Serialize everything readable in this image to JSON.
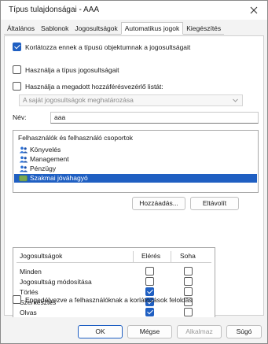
{
  "window": {
    "title": "Típus tulajdonságai - AAA"
  },
  "tabs": [
    {
      "label": "Általános",
      "active": false
    },
    {
      "label": "Sablonok",
      "active": false
    },
    {
      "label": "Jogosultságok",
      "active": false
    },
    {
      "label": "Automatikus jogok",
      "active": true
    },
    {
      "label": "Kiegészítés",
      "active": false
    }
  ],
  "options": {
    "restrict_label": "Korlátozza ennek a típusú objektumnak a jogosultságait",
    "restrict_checked": true,
    "use_type_perms_label": "Használja a típus jogosultságait",
    "use_type_perms_checked": false,
    "use_acl_label": "Használja a megadott hozzáférésvezérlő listát:",
    "use_acl_checked": false
  },
  "acl_dropdown": {
    "value": "A saját jogosultságok meghatározása"
  },
  "name_field": {
    "label": "Név:",
    "value": "aaa"
  },
  "groups": {
    "header": "Felhasználók és felhasználó csoportok",
    "items": [
      {
        "label": "Könyvelés",
        "icon": "user-group-icon",
        "selected": false
      },
      {
        "label": "Management",
        "icon": "user-group-icon",
        "selected": false
      },
      {
        "label": "Pénzügy",
        "icon": "user-group-icon",
        "selected": false
      },
      {
        "label": "Szakmai jóváhagyó",
        "icon": "role-tag-icon",
        "selected": true
      }
    ]
  },
  "buttons": {
    "add": "Hozzáadás...",
    "remove": "Eltávolít",
    "ok": "OK",
    "cancel": "Mégse",
    "apply": "Alkalmaz",
    "help": "Súgó"
  },
  "permissions": {
    "headers": {
      "name": "Jogosultságok",
      "allow": "Elérés",
      "deny": "Soha"
    },
    "rows": [
      {
        "label": "Minden",
        "allow": false,
        "deny": false
      },
      {
        "label": "Jogosultság módosítása",
        "allow": false,
        "deny": false
      },
      {
        "label": "Törlés",
        "allow": true,
        "deny": false
      },
      {
        "label": "Szerkesztés",
        "allow": true,
        "deny": false
      },
      {
        "label": "Olvas",
        "allow": true,
        "deny": false
      }
    ]
  },
  "bottom_option": {
    "label": "Engedélyezve a felhasználóknak a korlátozások feloldás",
    "checked": false
  },
  "colors": {
    "accent": "#1f5fc2",
    "window_bg": "#f3f3f3",
    "panel_bg": "#ffffff"
  }
}
